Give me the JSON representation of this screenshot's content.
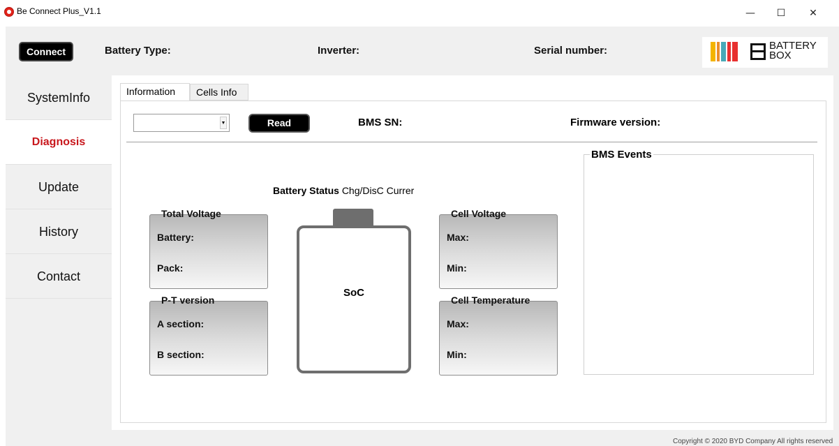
{
  "window": {
    "title": "Be Connect Plus_V1.1",
    "minimize": "—",
    "maximize": "☐",
    "close": "✕"
  },
  "header": {
    "connect_label": "Connect",
    "battery_type_label": "Battery Type:",
    "inverter_label": "Inverter:",
    "serial_number_label": "Serial number:",
    "logo_text_line1": "BATTERY",
    "logo_text_line2": "BOX"
  },
  "sidebar": {
    "items": [
      {
        "label": "SystemInfo",
        "active": false
      },
      {
        "label": "Diagnosis",
        "active": true
      },
      {
        "label": "Update",
        "active": false
      },
      {
        "label": "History",
        "active": false
      },
      {
        "label": "Contact",
        "active": false
      }
    ]
  },
  "tabs": [
    "Information",
    "Cells Info"
  ],
  "info": {
    "select_value": "",
    "read_label": "Read",
    "bms_sn_label": "BMS SN:",
    "firmware_label": "Firmware version:",
    "battery_status_label": "Battery Status",
    "chg_current_label": "Chg/DisC Currer",
    "soc_label": "SoC",
    "total_voltage": {
      "title": "Total Voltage",
      "row1": "Battery:",
      "row2": "Pack:"
    },
    "pt_version": {
      "title": "P-T version",
      "row1": "A section:",
      "row2": "B section:"
    },
    "cell_voltage": {
      "title": "Cell Voltage",
      "row1": "Max:",
      "row2": "Min:"
    },
    "cell_temperature": {
      "title": "Cell Temperature",
      "row1": "Max:",
      "row2": "Min:"
    },
    "bms_events_label": "BMS Events"
  },
  "footer": {
    "copyright": "Copyright © 2020 BYD Company All rights reserved"
  },
  "colors": {
    "accent_active": "#c8171c",
    "button_bg": "#000000",
    "logo_yellow": "#f4b400",
    "logo_orange": "#ec8d2b",
    "logo_teal": "#48a9b8",
    "logo_red": "#e8302f"
  }
}
